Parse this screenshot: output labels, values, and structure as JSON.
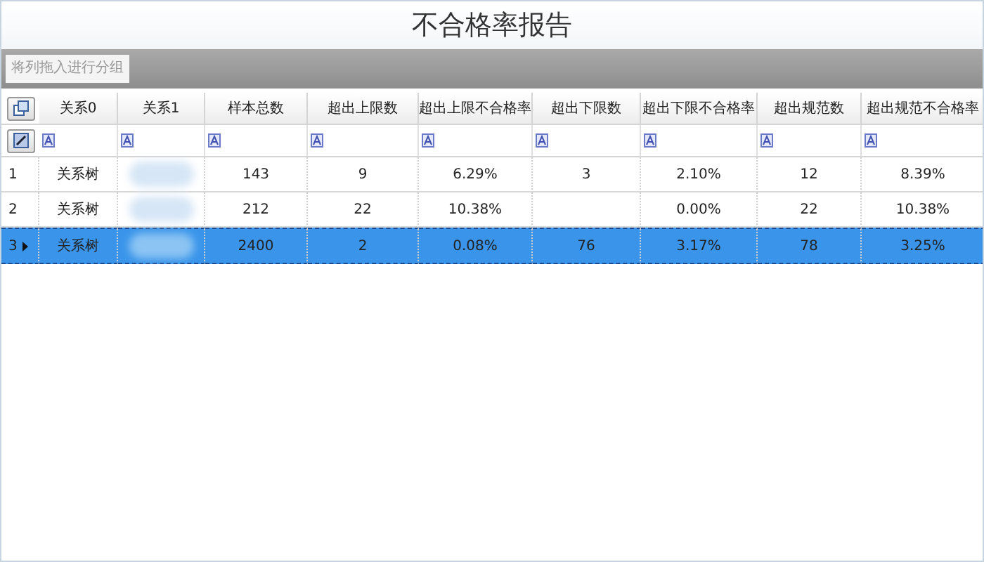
{
  "window": {
    "title": "不合格率报告"
  },
  "group_panel": {
    "placeholder": "将列拖入进行分组"
  },
  "table": {
    "columns": [
      "关系0",
      "关系1",
      "样本总数",
      "超出上限数",
      "超出上限不合格率",
      "超出下限数",
      "超出下限不合格率",
      "超出规范数",
      "超出规范不合格率"
    ],
    "rows": [
      {
        "index": "1",
        "selected": false,
        "cells": [
          "关系树",
          null,
          "143",
          "9",
          "6.29%",
          "3",
          "2.10%",
          "12",
          "8.39%"
        ]
      },
      {
        "index": "2",
        "selected": false,
        "cells": [
          "关系树",
          null,
          "212",
          "22",
          "10.38%",
          "",
          "0.00%",
          "22",
          "10.38%"
        ]
      },
      {
        "index": "3",
        "selected": true,
        "cells": [
          "关系树",
          null,
          "2400",
          "2",
          "0.08%",
          "76",
          "3.17%",
          "78",
          "3.25%"
        ]
      }
    ]
  }
}
